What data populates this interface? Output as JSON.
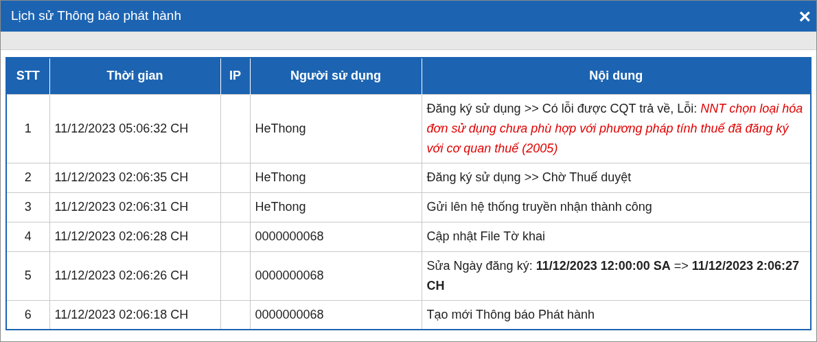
{
  "window": {
    "title": "Lịch sử Thông báo phát hành",
    "close": "×"
  },
  "table": {
    "columns": [
      "STT",
      "Thời gian",
      "IP",
      "Người sử dụng",
      "Nội dung"
    ],
    "rows": [
      {
        "stt": "1",
        "time": "11/12/2023 05:06:32 CH",
        "ip": "",
        "user": "HeThong",
        "content": "Đăng ký sử dụng >> Có lỗi được CQT trả về, Lỗi: *NNT chọn loại hóa đơn sử dụng chưa phù hợp với phương pháp tính thuế đã đăng ký với cơ quan thuế (2005)*"
      },
      {
        "stt": "2",
        "time": "11/12/2023 02:06:35 CH",
        "ip": "",
        "user": "HeThong",
        "content": "Đăng ký sử dụng >> Chờ Thuế duyệt"
      },
      {
        "stt": "3",
        "time": "11/12/2023 02:06:31 CH",
        "ip": "",
        "user": "HeThong",
        "content": "Gửi lên hệ thống truyền nhận thành công"
      },
      {
        "stt": "4",
        "time": "11/12/2023 02:06:28 CH",
        "ip": "",
        "user": "0000000068",
        "content": "Cập nhật File Tờ khai"
      },
      {
        "stt": "5",
        "time": "11/12/2023 02:06:26 CH",
        "ip": "",
        "user": "0000000068",
        "content": "Sửa Ngày đăng ký: **11/12/2023 12:00:00 SA** => **11/12/2023 2:06:27 CH**"
      },
      {
        "stt": "6",
        "time": "11/12/2023 02:06:18 CH",
        "ip": "",
        "user": "0000000068",
        "content": "Tạo mới Thông báo Phát hành"
      }
    ]
  }
}
